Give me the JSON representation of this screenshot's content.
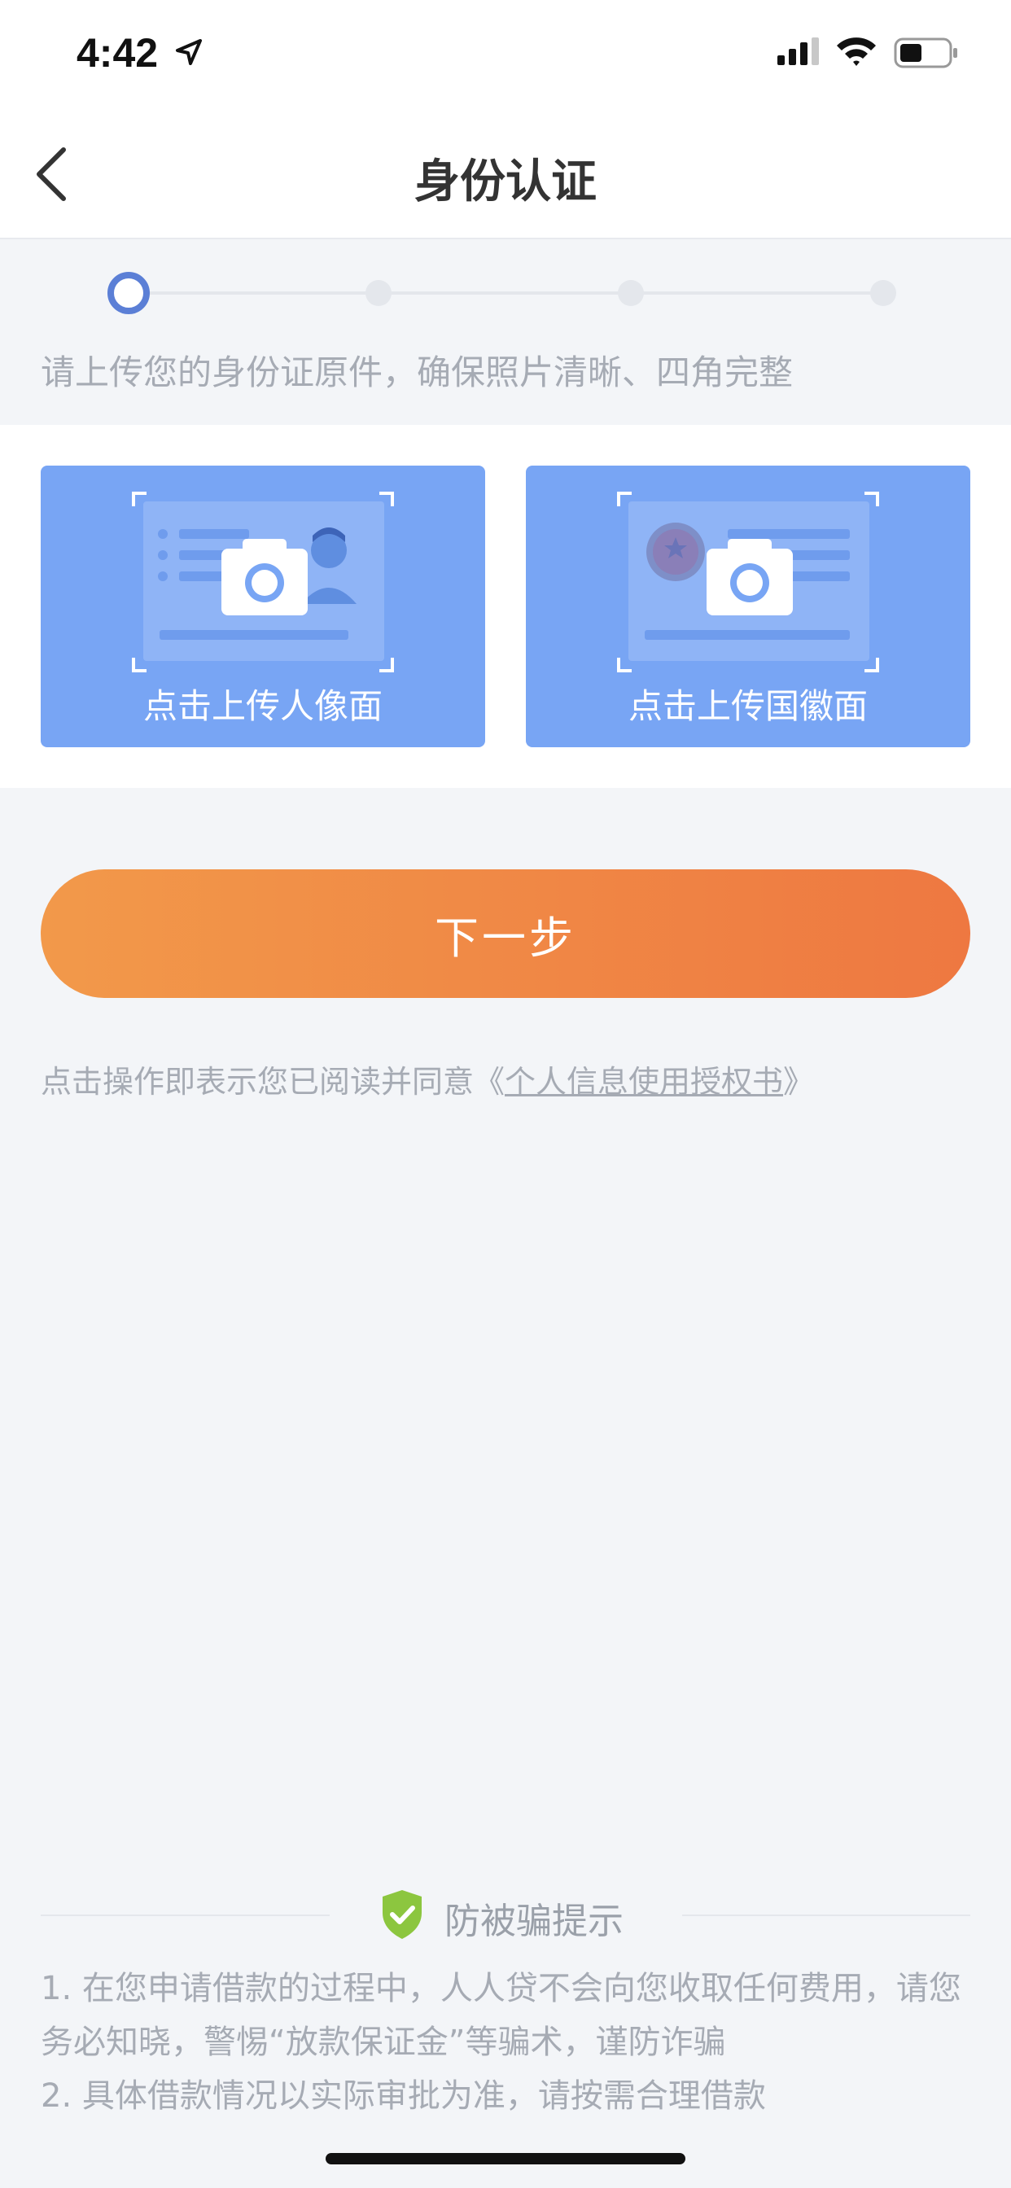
{
  "status_bar": {
    "time": "4:42"
  },
  "header": {
    "title": "身份认证"
  },
  "stepper": {
    "current_step": 1,
    "total_steps": 4
  },
  "instruction": "请上传您的身份证原件，确保照片清晰、四角完整",
  "upload": {
    "front_label": "点击上传人像面",
    "back_label": "点击上传国徽面"
  },
  "next_button_label": "下一步",
  "consent": {
    "text": "点击操作即表示您已阅读并同意《",
    "link": "个人信息使用授权书",
    "suffix": "》"
  },
  "anti_fraud": {
    "title": "防被骗提示",
    "notes": [
      "1. 在您申请借款的过程中，人人贷不会向您收取任何费用，请您务必知晓，警惕“放款保证金”等骗术，谨防诈骗",
      "2. 具体借款情况以实际审批为准，请按需合理借款"
    ]
  },
  "colors": {
    "accent": "#5b7fd6",
    "card_bg": "#78a5f4",
    "button_start": "#f2994a",
    "button_end": "#ee7841",
    "shield": "#8cc63f"
  }
}
